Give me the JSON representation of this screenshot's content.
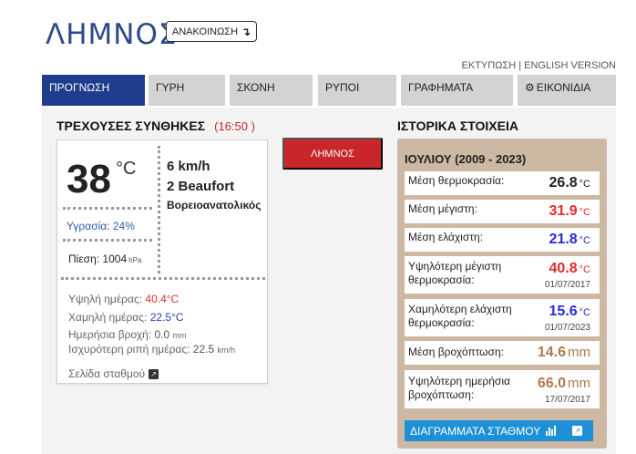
{
  "header": {
    "station_title": "ΛΗΜΝΟΣ",
    "announce_label": "ΑΝΑΚΟΙΝΩΣΗ",
    "announce_icon": "↴",
    "print_link": "ΕΚΤΥΠΩΣΗ",
    "link_separator": " | ",
    "english_link": "ENGLISH VERSION"
  },
  "tabs": [
    {
      "label": "ΠΡΟΓΝΩΣΗ",
      "active": true
    },
    {
      "label": "ΓΥΡΗ"
    },
    {
      "label": "ΣΚΟΝΗ"
    },
    {
      "label": "ΡΥΠΟΙ"
    },
    {
      "label": "ΓΡΑΦΗΜΑΤΑ"
    },
    {
      "label": "ΕΙΚΟΝΙΔΙΑ",
      "icon": "gear-icon"
    }
  ],
  "current": {
    "heading": "ΤΡΕΧΟΥΣΕΣ ΣΥΝΘΗΚΕΣ",
    "time": "(16:50 )",
    "temperature": "38",
    "temp_unit": "°C",
    "humidity": "Υγρασία: 24%",
    "pressure_label": "Πίεση: 1004",
    "pressure_unit": "hPa",
    "wind_speed": "6 km/h",
    "wind_beaufort": "2 Beaufort",
    "wind_direction": "Βορειοανατολικός",
    "high_label": "Υψηλή ημέρας:",
    "high_value": "40.4°C",
    "low_label": "Χαμηλή ημέρας:",
    "low_value": "22.5°C",
    "rain_label": "Ημερήσια βροχή:",
    "rain_value": "0.0",
    "rain_unit": "mm",
    "gust_label": "Ισχυρότερη ριπή ημέρας:",
    "gust_value": "22.5",
    "gust_unit": "km/h",
    "station_page": "Σελίδα σταθμού"
  },
  "station_button": "ΛΗΜΝΟΣ",
  "history": {
    "heading": "ΙΣΤΟΡΙΚΑ ΣΤΟΙΧΕΙΑ",
    "period": "ΙΟΥΛΙΟΥ (2009 - 2023)",
    "rows": [
      {
        "label": "Μέση θερμοκρασία:",
        "value": "26.8",
        "unit": "°C"
      },
      {
        "label": "Μέση μέγιστη:",
        "value": "31.9",
        "unit": "°C"
      },
      {
        "label": "Μέση ελάχιστη:",
        "value": "21.8",
        "unit": "°C"
      },
      {
        "label1": "Υψηλότερη μέγιστη",
        "label2": "θερμοκρασία:",
        "value": "40.8",
        "unit": "°C",
        "date": "01/07/2017"
      },
      {
        "label1": "Χαμηλότερη ελάχιστη",
        "label2": "θερμοκρασία:",
        "value": "15.6",
        "unit": "°C",
        "date": "01/07/2023"
      },
      {
        "label": "Μέση βροχόπτωση:",
        "value": "14.6",
        "unit": "mm"
      },
      {
        "label1": "Υψηλότερη ημερήσια",
        "label2": "βροχόπτωση:",
        "value": "66.0",
        "unit": "mm",
        "date": "17/07/2017"
      }
    ],
    "charts_button": "ΔΙΑΓΡΑΜΜΑΤΑ ΣΤΑΘΜΟΥ"
  },
  "colors": {
    "brand_blue": "#1f3d8c",
    "red": "#c9262c",
    "history_bg": "#cdb8a4",
    "charts_blue": "#1e90d6"
  }
}
